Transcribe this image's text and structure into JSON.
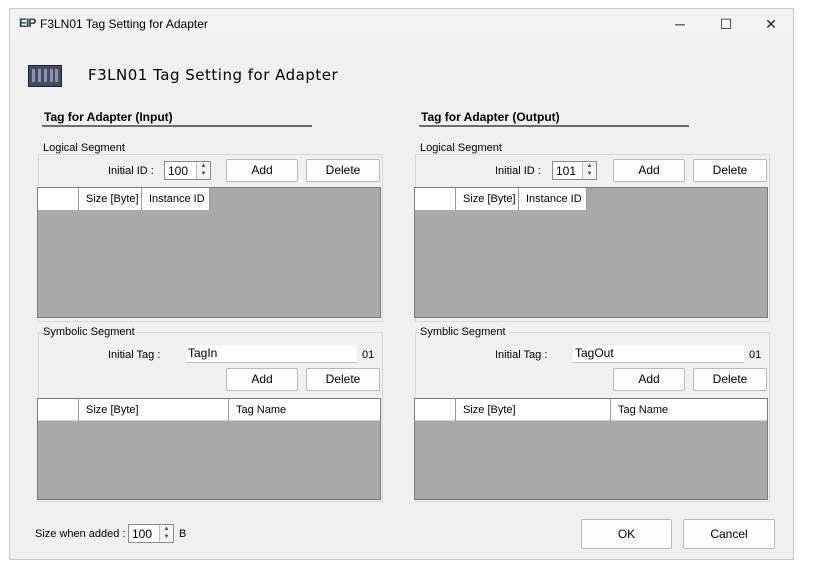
{
  "window": {
    "title": "F3LN01 Tag Setting for Adapter",
    "app_icon": "EIP",
    "icons": {
      "app": "eip-icon",
      "device": "plc-rack-icon"
    },
    "controls": {
      "minimize": "─",
      "maximize": "☐",
      "close": "✕"
    }
  },
  "header": {
    "title": "F3LN01 Tag Setting for Adapter"
  },
  "input_section": {
    "title": "Tag for Adapter (Input)",
    "logical": {
      "group_label": "Logical Segment",
      "initial_id_label": "Initial ID :",
      "initial_id_value": "100",
      "add_label": "Add",
      "delete_label": "Delete",
      "columns": [
        "",
        "Size [Byte]",
        "Instance ID"
      ]
    },
    "symbolic": {
      "group_label": "Symbolic Segment",
      "initial_tag_label": "Initial Tag :",
      "initial_tag_value": "TagIn",
      "suffix": "01",
      "add_label": "Add",
      "delete_label": "Delete",
      "columns": [
        "",
        "Size [Byte]",
        "Tag Name"
      ]
    }
  },
  "output_section": {
    "title": "Tag for Adapter (Output)",
    "logical": {
      "group_label": "Logical Segment",
      "initial_id_label": "Initial ID :",
      "initial_id_value": "101",
      "add_label": "Add",
      "delete_label": "Delete",
      "columns": [
        "",
        "Size [Byte]",
        "Instance ID"
      ]
    },
    "symbolic": {
      "group_label": "Symblic Segment",
      "initial_tag_label": "Initial Tag :",
      "initial_tag_value": "TagOut",
      "suffix": "01",
      "add_label": "Add",
      "delete_label": "Delete",
      "columns": [
        "",
        "Size [Byte]",
        "Tag Name"
      ]
    }
  },
  "footer": {
    "size_label": "Size when added :",
    "size_value": "100",
    "size_unit": "B",
    "ok_label": "OK",
    "cancel_label": "Cancel"
  },
  "colors": {
    "window_bg": "#f0f0f0",
    "grid_bg": "#a9a9a9",
    "section_rule": "#6d6d6d"
  }
}
